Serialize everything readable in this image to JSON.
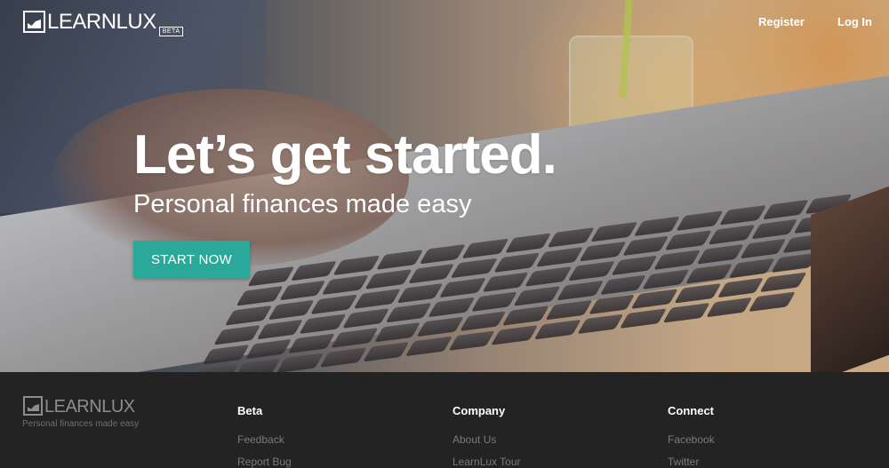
{
  "header": {
    "logo_text": "LEARNLUX",
    "beta_badge": "BETA",
    "nav": {
      "register": "Register",
      "login": "Log In"
    }
  },
  "hero": {
    "headline": "Let’s get started.",
    "subhead": "Personal finances made easy",
    "cta_label": "START NOW"
  },
  "footer": {
    "logo_text": "LEARNLUX",
    "tagline": "Personal finances made easy",
    "columns": [
      {
        "title": "Beta",
        "links": [
          "Feedback",
          "Report Bug"
        ]
      },
      {
        "title": "Company",
        "links": [
          "About Us",
          "LearnLux Tour"
        ]
      },
      {
        "title": "Connect",
        "links": [
          "Facebook",
          "Twitter"
        ]
      }
    ]
  },
  "colors": {
    "accent": "#2aa99a",
    "footer_bg": "#232323"
  }
}
